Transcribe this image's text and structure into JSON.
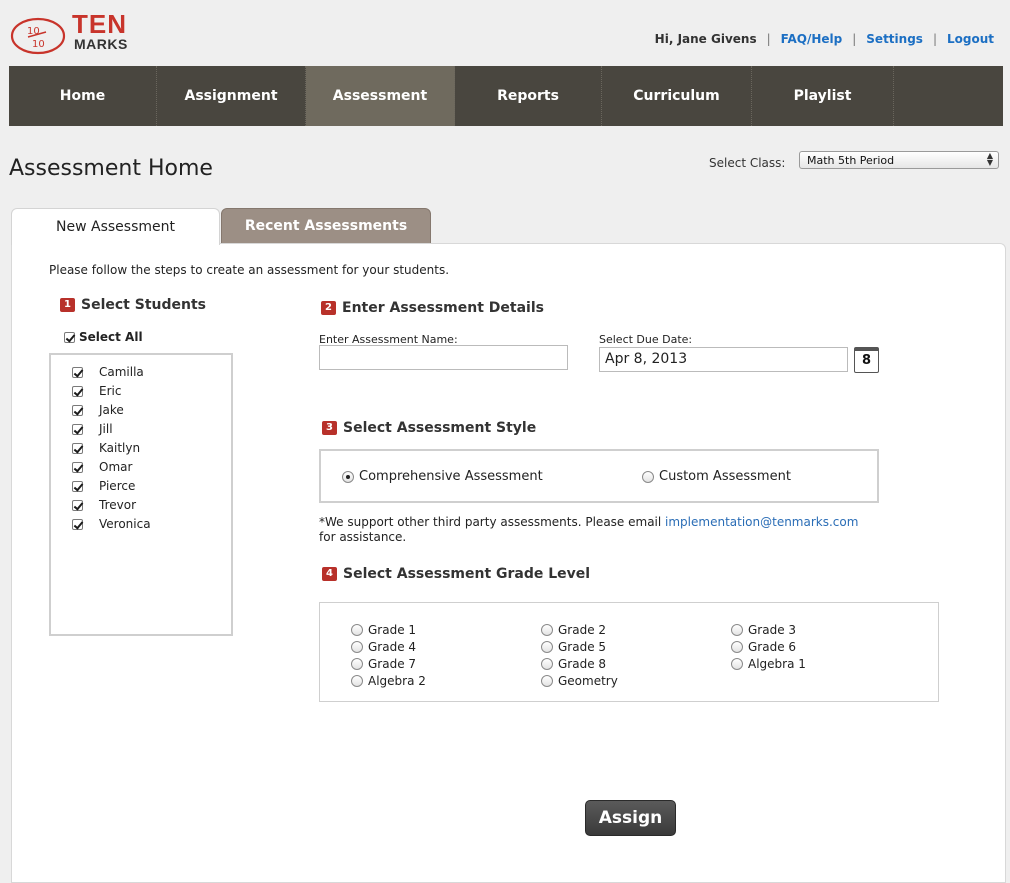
{
  "brand": {
    "logo_top": "TEN",
    "logo_bottom": "MARKS",
    "logo_badge": "10/10"
  },
  "userbar": {
    "greeting": "Hi, Jane Givens",
    "faq": "FAQ/Help",
    "settings": "Settings",
    "logout": "Logout",
    "separator": "|"
  },
  "nav": {
    "items": [
      "Home",
      "Assignment",
      "Assessment",
      "Reports",
      "Curriculum",
      "Playlist"
    ],
    "active": "Assessment"
  },
  "page": {
    "title": "Assessment Home"
  },
  "class_select": {
    "label": "Select Class:",
    "value": "Math 5th Period"
  },
  "tabs": {
    "new": "New Assessment",
    "recent": "Recent Assessments",
    "active": "New Assessment"
  },
  "intro": "Please follow the steps to create an assessment for your students.",
  "step1": {
    "number": "1",
    "title": "Select Students",
    "select_all": "Select All",
    "select_all_checked": true,
    "students": [
      {
        "name": "Camilla",
        "checked": true
      },
      {
        "name": "Eric",
        "checked": true
      },
      {
        "name": "Jake",
        "checked": true
      },
      {
        "name": "Jill",
        "checked": true
      },
      {
        "name": "Kaitlyn",
        "checked": true
      },
      {
        "name": "Omar",
        "checked": true
      },
      {
        "name": "Pierce",
        "checked": true
      },
      {
        "name": "Trevor",
        "checked": true
      },
      {
        "name": "Veronica",
        "checked": true
      }
    ]
  },
  "step2": {
    "number": "2",
    "title": "Enter Assessment Details",
    "name_label": "Enter Assessment Name:",
    "name_value": "",
    "date_label": "Select Due Date:",
    "date_value": "Apr 8, 2013",
    "calendar_day": "8"
  },
  "step3": {
    "number": "3",
    "title": "Select Assessment Style",
    "options": [
      "Comprehensive Assessment",
      "Custom Assessment"
    ],
    "selected": "Comprehensive Assessment",
    "note_prefix": "*We support other third party assessments. Please email ",
    "note_email": "implementation@tenmarks.com",
    "note_suffix": "for assistance."
  },
  "step4": {
    "number": "4",
    "title": "Select Assessment Grade Level",
    "grades": [
      "Grade 1",
      "Grade 2",
      "Grade 3",
      "Grade 4",
      "Grade 5",
      "Grade 6",
      "Grade 7",
      "Grade 8",
      "Algebra 1",
      "Algebra 2",
      "Geometry"
    ]
  },
  "assign_button": "Assign",
  "colors": {
    "brand_red": "#c8342b",
    "nav_bg": "#49463f",
    "nav_active": "#6f6a5e",
    "link_blue": "#1c6fc3",
    "step_badge": "#b8312a"
  }
}
